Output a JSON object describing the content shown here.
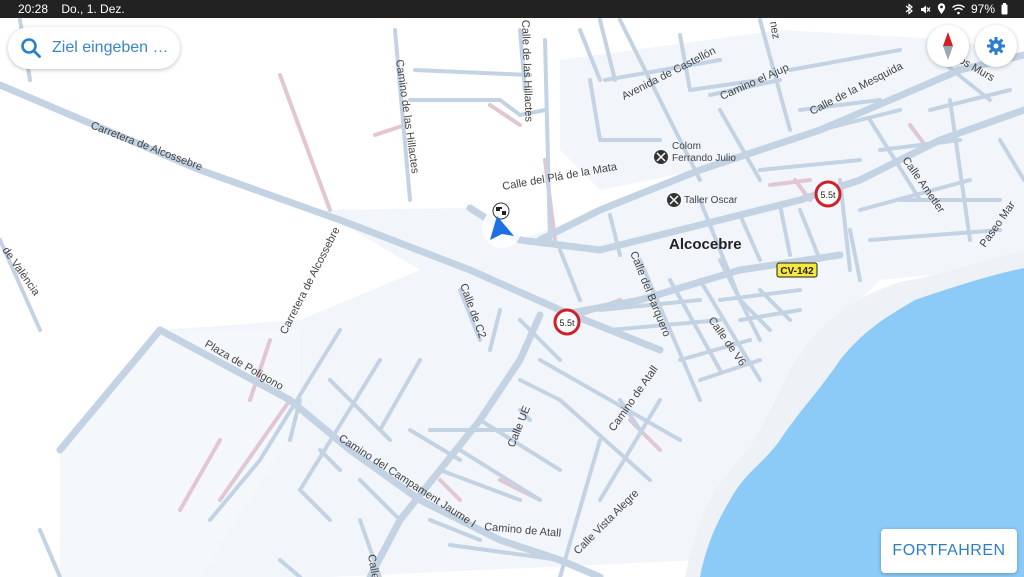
{
  "status_bar": {
    "time": "20:28",
    "date": "Do., 1. Dez.",
    "battery": "97%",
    "icons": [
      "bluetooth-icon",
      "mute-icon",
      "location-icon",
      "wifi-icon",
      "battery-icon"
    ]
  },
  "search": {
    "placeholder": "Ziel eingeben …",
    "icon": "search-icon"
  },
  "controls": {
    "compass_icon": "compass-icon",
    "settings_icon": "gear-icon"
  },
  "continue_button": {
    "label": "FORTFAHREN"
  },
  "map": {
    "town_label": "Alcocebre",
    "road_shield": "CV-142",
    "weight_limits": [
      "5.5t",
      "5.5t"
    ],
    "pois": [
      {
        "name": "Colom Ferrando Julio",
        "line1": "Colom",
        "line2": "Ferrando Julio",
        "icon": "tools-icon"
      },
      {
        "name": "Taller Oscar",
        "icon": "tools-icon"
      }
    ],
    "street_labels": [
      "Carretera de Alcossebre",
      "Camino de las Hillactes",
      "Calle de las Hillactes",
      "Avenida de Castellón",
      "Camino el Ajup",
      "Calle de la Mesquida",
      "Calle del Plá de la Mata",
      "Calle Ametler",
      "Paseo Mar",
      "Calle de C2",
      "Carretera de Alcossebre",
      "Plaza de Poligono",
      "Calle del Barquero",
      "Calle de V6",
      "Camino de Atall",
      "Calle UE",
      "Camino del Campament Jaume I",
      "Camino de Atall",
      "Calle Vista Alegre",
      "de València",
      "Calle",
      "os Murs",
      "nez"
    ],
    "colors": {
      "water": "#8ccaf7",
      "land": "#ffffff",
      "urban": "#f2f6fb",
      "road": "#c3d3e4",
      "pink_road": "#e2c6d3",
      "position": "#1e6fe0",
      "restriction": "#d0202a"
    }
  }
}
